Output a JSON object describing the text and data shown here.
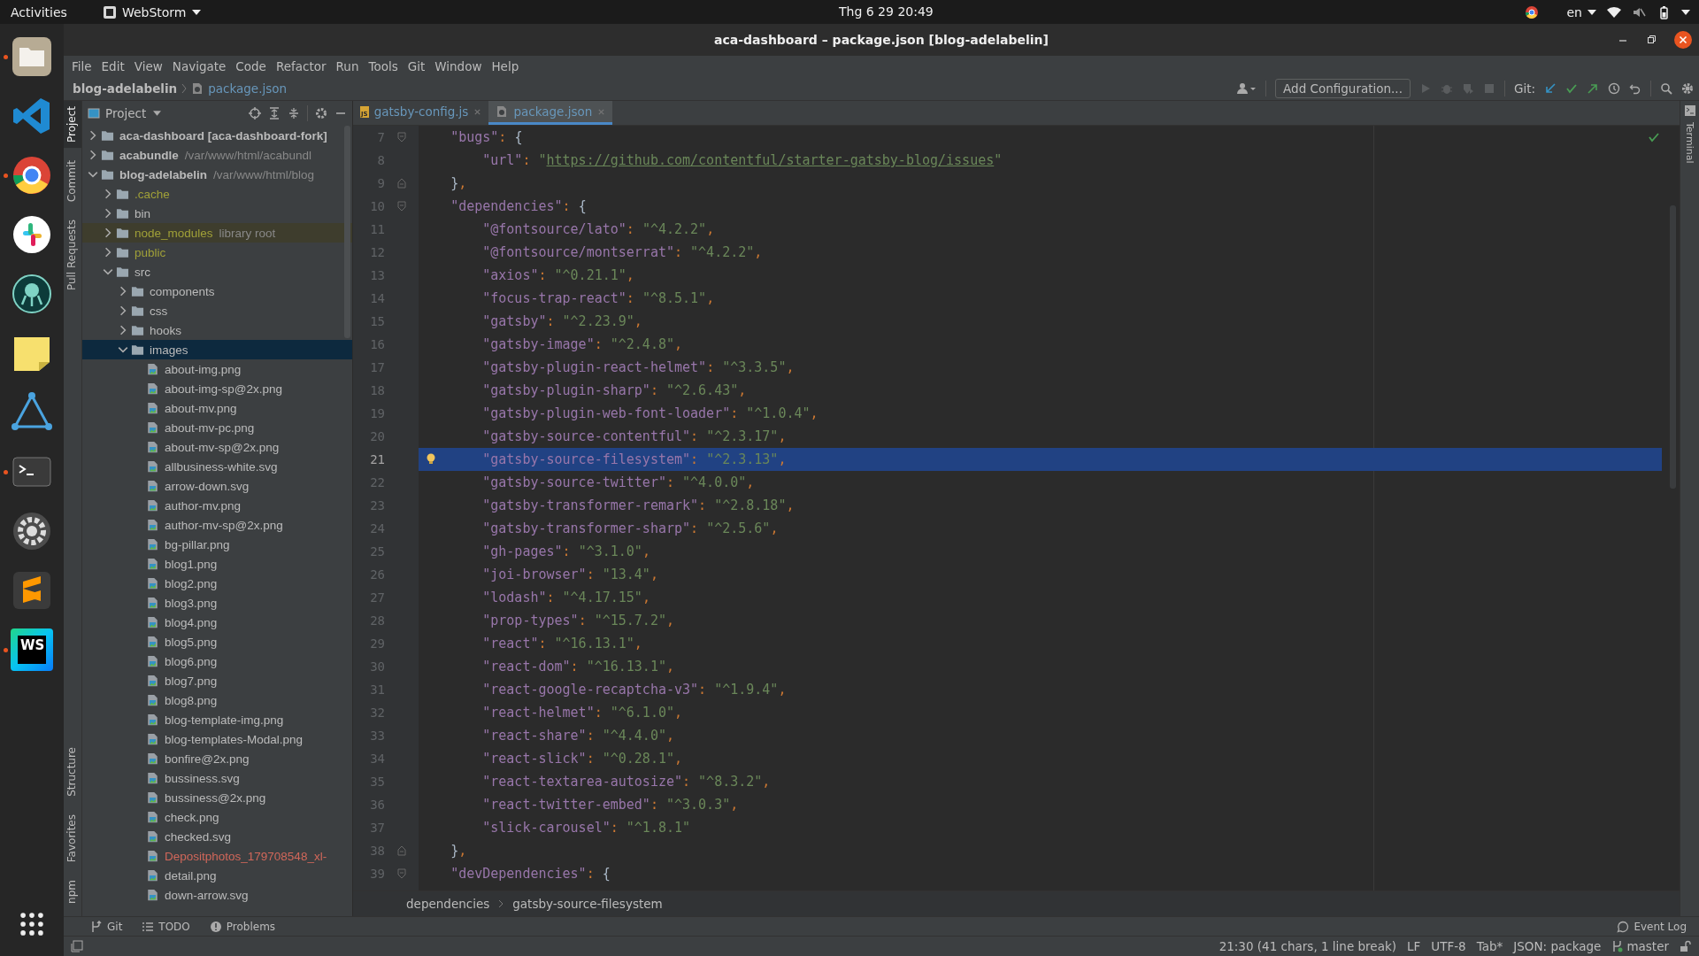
{
  "top_bar": {
    "activities": "Activities",
    "app_menu": "WebStorm",
    "clock": "Thg 6 29  20:49",
    "language": "en"
  },
  "dock": [
    {
      "kind": "files",
      "running": true
    },
    {
      "kind": "vscode",
      "running": false
    },
    {
      "kind": "chrome",
      "running": true
    },
    {
      "kind": "slack",
      "running": false
    },
    {
      "kind": "gitkraken",
      "running": false
    },
    {
      "kind": "notes",
      "running": false
    },
    {
      "kind": "triangle",
      "running": false
    },
    {
      "kind": "terminal",
      "running": true
    },
    {
      "kind": "settings",
      "running": false
    },
    {
      "kind": "sublime",
      "running": false
    },
    {
      "kind": "webstorm",
      "running": true,
      "label": "WS"
    },
    {
      "kind": "apps",
      "running": false
    }
  ],
  "window": {
    "title": "aca-dashboard – package.json [blog-adelabelin]"
  },
  "menu": [
    "File",
    "Edit",
    "View",
    "Navigate",
    "Code",
    "Refactor",
    "Run",
    "Tools",
    "Git",
    "Window",
    "Help"
  ],
  "nav": {
    "project": "blog-adelabelin",
    "file": "package.json",
    "run_config": "Add Configuration...",
    "git_label": "Git:"
  },
  "left_strip": {
    "top": [
      {
        "label": "Project",
        "selected": true
      },
      {
        "label": "Commit",
        "selected": false
      },
      {
        "label": "Pull Requests",
        "selected": false
      }
    ],
    "bottom": [
      {
        "label": "Structure",
        "selected": false
      },
      {
        "label": "Favorites",
        "selected": false
      },
      {
        "label": "npm",
        "selected": false
      }
    ]
  },
  "project_panel": {
    "title": "Project",
    "tree": [
      {
        "name": "aca-dashboard **[aca-dashboard-fork]**",
        "kind": "root",
        "color": "#bbbbbb",
        "expanded": false,
        "selected": false
      },
      {
        "name": "acabundle",
        "detail": "/var/www/html/acabundl",
        "kind": "root",
        "color": "#bbbbbb",
        "expanded": false,
        "selected": false
      },
      {
        "name": "blog-adelabelin",
        "detail": "/var/www/html/blog",
        "kind": "root",
        "color": "#bbbbbb",
        "expanded": true,
        "selected": false,
        "children": [
          {
            "name": ".cache",
            "kind": "folder",
            "color": "#a0a038",
            "expanded": false,
            "selected": false
          },
          {
            "name": "bin",
            "kind": "folder",
            "color": "#bbbbbb",
            "expanded": false,
            "selected": false
          },
          {
            "name": "node_modules",
            "detail": "library root",
            "kind": "library",
            "color": "#a0a038",
            "expanded": false,
            "selected": false
          },
          {
            "name": "public",
            "kind": "folder",
            "color": "#a0a038",
            "expanded": false,
            "selected": false
          },
          {
            "name": "src",
            "kind": "folder",
            "color": "#bbbbbb",
            "expanded": true,
            "selected": false,
            "children": [
              {
                "name": "components",
                "kind": "folder",
                "color": "#bbbbbb",
                "expanded": false,
                "selected": false
              },
              {
                "name": "css",
                "kind": "folder",
                "color": "#bbbbbb",
                "expanded": false,
                "selected": false
              },
              {
                "name": "hooks",
                "kind": "folder",
                "color": "#bbbbbb",
                "expanded": false,
                "selected": false
              },
              {
                "name": "images",
                "kind": "folder",
                "color": "#bbbbbb",
                "expanded": true,
                "selected": true,
                "children": [
                  {
                    "name": "about-img.png",
                    "kind": "file",
                    "color": "#bbbbbb",
                    "selected": false
                  },
                  {
                    "name": "about-img-sp@2x.png",
                    "kind": "file",
                    "color": "#bbbbbb",
                    "selected": false
                  },
                  {
                    "name": "about-mv.png",
                    "kind": "file",
                    "color": "#bbbbbb",
                    "selected": false
                  },
                  {
                    "name": "about-mv-pc.png",
                    "kind": "file",
                    "color": "#bbbbbb",
                    "selected": false
                  },
                  {
                    "name": "about-mv-sp@2x.png",
                    "kind": "file",
                    "color": "#bbbbbb",
                    "selected": false
                  },
                  {
                    "name": "allbusiness-white.svg",
                    "kind": "file",
                    "color": "#bbbbbb",
                    "selected": false
                  },
                  {
                    "name": "arrow-down.svg",
                    "kind": "file",
                    "color": "#bbbbbb",
                    "selected": false
                  },
                  {
                    "name": "author-mv.png",
                    "kind": "file",
                    "color": "#bbbbbb",
                    "selected": false
                  },
                  {
                    "name": "author-mv-sp@2x.png",
                    "kind": "file",
                    "color": "#bbbbbb",
                    "selected": false
                  },
                  {
                    "name": "bg-pillar.png",
                    "kind": "file",
                    "color": "#bbbbbb",
                    "selected": false
                  },
                  {
                    "name": "blog1.png",
                    "kind": "file",
                    "color": "#bbbbbb",
                    "selected": false
                  },
                  {
                    "name": "blog2.png",
                    "kind": "file",
                    "color": "#bbbbbb",
                    "selected": false
                  },
                  {
                    "name": "blog3.png",
                    "kind": "file",
                    "color": "#bbbbbb",
                    "selected": false
                  },
                  {
                    "name": "blog4.png",
                    "kind": "file",
                    "color": "#bbbbbb",
                    "selected": false
                  },
                  {
                    "name": "blog5.png",
                    "kind": "file",
                    "color": "#bbbbbb",
                    "selected": false
                  },
                  {
                    "name": "blog6.png",
                    "kind": "file",
                    "color": "#bbbbbb",
                    "selected": false
                  },
                  {
                    "name": "blog7.png",
                    "kind": "file",
                    "color": "#bbbbbb",
                    "selected": false
                  },
                  {
                    "name": "blog8.png",
                    "kind": "file",
                    "color": "#bbbbbb",
                    "selected": false
                  },
                  {
                    "name": "blog-template-img.png",
                    "kind": "file",
                    "color": "#bbbbbb",
                    "selected": false
                  },
                  {
                    "name": "blog-templates-Modal.png",
                    "kind": "file",
                    "color": "#bbbbbb",
                    "selected": false
                  },
                  {
                    "name": "bonfire@2x.png",
                    "kind": "file",
                    "color": "#bbbbbb",
                    "selected": false
                  },
                  {
                    "name": "bussiness.svg",
                    "kind": "file",
                    "color": "#bbbbbb",
                    "selected": false
                  },
                  {
                    "name": "bussiness@2x.png",
                    "kind": "file",
                    "color": "#bbbbbb",
                    "selected": false
                  },
                  {
                    "name": "check.png",
                    "kind": "file",
                    "color": "#bbbbbb",
                    "selected": false
                  },
                  {
                    "name": "checked.svg",
                    "kind": "file",
                    "color": "#bbbbbb",
                    "selected": false
                  },
                  {
                    "name": "Depositphotos_179708548_xl-",
                    "kind": "file",
                    "color": "#d1675a",
                    "selected": false
                  },
                  {
                    "name": "detail.png",
                    "kind": "file",
                    "color": "#bbbbbb",
                    "selected": false
                  },
                  {
                    "name": "down-arrow.svg",
                    "kind": "file",
                    "color": "#bbbbbb",
                    "selected": false
                  }
                ]
              }
            ]
          }
        ]
      }
    ]
  },
  "tabs": [
    {
      "label": "gatsby-config.js",
      "kind": "js",
      "badge": "JS",
      "selected": false
    },
    {
      "label": "package.json",
      "kind": "json",
      "selected": true
    }
  ],
  "editor": {
    "lines": [
      {
        "number": "7",
        "selected": false,
        "kind": "fold-start",
        "tokens": [
          {
            "kind": "key",
            "text": "    \"bugs\""
          },
          {
            "kind": "punct",
            "text": ": "
          },
          {
            "kind": "brace",
            "text": "{"
          }
        ]
      },
      {
        "number": "8",
        "selected": false,
        "tokens": [
          {
            "kind": "key",
            "text": "        \"url\""
          },
          {
            "kind": "punct",
            "text": ": "
          },
          {
            "kind": "string",
            "text": "\""
          },
          {
            "kind": "url",
            "text": "https://github.com/contentful/starter-gatsby-blog/issues"
          },
          {
            "kind": "string",
            "text": "\""
          }
        ]
      },
      {
        "number": "9",
        "selected": false,
        "kind": "fold-end",
        "tokens": [
          {
            "kind": "brace",
            "text": "    }"
          },
          {
            "kind": "punct",
            "text": ","
          }
        ]
      },
      {
        "number": "10",
        "selected": false,
        "kind": "fold-start",
        "tokens": [
          {
            "kind": "key",
            "text": "    \"dependencies\""
          },
          {
            "kind": "punct",
            "text": ": "
          },
          {
            "kind": "brace",
            "text": "{"
          }
        ]
      },
      {
        "number": "11",
        "selected": false,
        "tokens": [
          {
            "kind": "key",
            "text": "        \"@fontsource/lato\""
          },
          {
            "kind": "punct",
            "text": ": "
          },
          {
            "kind": "string",
            "text": "\"^4.2.2\""
          },
          {
            "kind": "punct",
            "text": ","
          }
        ]
      },
      {
        "number": "12",
        "selected": false,
        "tokens": [
          {
            "kind": "key",
            "text": "        \"@fontsource/montserrat\""
          },
          {
            "kind": "punct",
            "text": ": "
          },
          {
            "kind": "string",
            "text": "\"^4.2.2\""
          },
          {
            "kind": "punct",
            "text": ","
          }
        ]
      },
      {
        "number": "13",
        "selected": false,
        "tokens": [
          {
            "kind": "key",
            "text": "        \"axios\""
          },
          {
            "kind": "punct",
            "text": ": "
          },
          {
            "kind": "string",
            "text": "\"^0.21.1\""
          },
          {
            "kind": "punct",
            "text": ","
          }
        ]
      },
      {
        "number": "14",
        "selected": false,
        "tokens": [
          {
            "kind": "key",
            "text": "        \"focus-trap-react\""
          },
          {
            "kind": "punct",
            "text": ": "
          },
          {
            "kind": "string",
            "text": "\"^8.5.1\""
          },
          {
            "kind": "punct",
            "text": ","
          }
        ]
      },
      {
        "number": "15",
        "selected": false,
        "tokens": [
          {
            "kind": "key",
            "text": "        \"gatsby\""
          },
          {
            "kind": "punct",
            "text": ": "
          },
          {
            "kind": "string",
            "text": "\"^2.23.9\""
          },
          {
            "kind": "punct",
            "text": ","
          }
        ]
      },
      {
        "number": "16",
        "selected": false,
        "tokens": [
          {
            "kind": "key",
            "text": "        \"gatsby-image\""
          },
          {
            "kind": "punct",
            "text": ": "
          },
          {
            "kind": "string",
            "text": "\"^2.4.8\""
          },
          {
            "kind": "punct",
            "text": ","
          }
        ]
      },
      {
        "number": "17",
        "selected": false,
        "tokens": [
          {
            "kind": "key",
            "text": "        \"gatsby-plugin-react-helmet\""
          },
          {
            "kind": "punct",
            "text": ": "
          },
          {
            "kind": "string",
            "text": "\"^3.3.5\""
          },
          {
            "kind": "punct",
            "text": ","
          }
        ]
      },
      {
        "number": "18",
        "selected": false,
        "tokens": [
          {
            "kind": "key",
            "text": "        \"gatsby-plugin-sharp\""
          },
          {
            "kind": "punct",
            "text": ": "
          },
          {
            "kind": "string",
            "text": "\"^2.6.43\""
          },
          {
            "kind": "punct",
            "text": ","
          }
        ]
      },
      {
        "number": "19",
        "selected": false,
        "tokens": [
          {
            "kind": "key",
            "text": "        \"gatsby-plugin-web-font-loader\""
          },
          {
            "kind": "punct",
            "text": ": "
          },
          {
            "kind": "string",
            "text": "\"^1.0.4\""
          },
          {
            "kind": "punct",
            "text": ","
          }
        ]
      },
      {
        "number": "20",
        "selected": false,
        "tokens": [
          {
            "kind": "key",
            "text": "        \"gatsby-source-contentful\""
          },
          {
            "kind": "punct",
            "text": ": "
          },
          {
            "kind": "string",
            "text": "\"^2.3.17\""
          },
          {
            "kind": "punct",
            "text": ","
          }
        ]
      },
      {
        "number": "21",
        "selected": true,
        "tokens": [
          {
            "kind": "key",
            "text": "        \"gatsby-source-filesystem\""
          },
          {
            "kind": "punct",
            "text": ": "
          },
          {
            "kind": "string",
            "text": "\"^2.3.13\""
          },
          {
            "kind": "punct",
            "text": ","
          }
        ]
      },
      {
        "number": "22",
        "selected": false,
        "tokens": [
          {
            "kind": "key",
            "text": "        \"gatsby-source-twitter\""
          },
          {
            "kind": "punct",
            "text": ": "
          },
          {
            "kind": "string",
            "text": "\"^4.0.0\""
          },
          {
            "kind": "punct",
            "text": ","
          }
        ]
      },
      {
        "number": "23",
        "selected": false,
        "tokens": [
          {
            "kind": "key",
            "text": "        \"gatsby-transformer-remark\""
          },
          {
            "kind": "punct",
            "text": ": "
          },
          {
            "kind": "string",
            "text": "\"^2.8.18\""
          },
          {
            "kind": "punct",
            "text": ","
          }
        ]
      },
      {
        "number": "24",
        "selected": false,
        "tokens": [
          {
            "kind": "key",
            "text": "        \"gatsby-transformer-sharp\""
          },
          {
            "kind": "punct",
            "text": ": "
          },
          {
            "kind": "string",
            "text": "\"^2.5.6\""
          },
          {
            "kind": "punct",
            "text": ","
          }
        ]
      },
      {
        "number": "25",
        "selected": false,
        "tokens": [
          {
            "kind": "key",
            "text": "        \"gh-pages\""
          },
          {
            "kind": "punct",
            "text": ": "
          },
          {
            "kind": "string",
            "text": "\"^3.1.0\""
          },
          {
            "kind": "punct",
            "text": ","
          }
        ]
      },
      {
        "number": "26",
        "selected": false,
        "tokens": [
          {
            "kind": "key",
            "text": "        \"joi-browser\""
          },
          {
            "kind": "punct",
            "text": ": "
          },
          {
            "kind": "string",
            "text": "\"13.4\""
          },
          {
            "kind": "punct",
            "text": ","
          }
        ]
      },
      {
        "number": "27",
        "selected": false,
        "tokens": [
          {
            "kind": "key",
            "text": "        \"lodash\""
          },
          {
            "kind": "punct",
            "text": ": "
          },
          {
            "kind": "string",
            "text": "\"^4.17.15\""
          },
          {
            "kind": "punct",
            "text": ","
          }
        ]
      },
      {
        "number": "28",
        "selected": false,
        "tokens": [
          {
            "kind": "key",
            "text": "        \"prop-types\""
          },
          {
            "kind": "punct",
            "text": ": "
          },
          {
            "kind": "string",
            "text": "\"^15.7.2\""
          },
          {
            "kind": "punct",
            "text": ","
          }
        ]
      },
      {
        "number": "29",
        "selected": false,
        "tokens": [
          {
            "kind": "key",
            "text": "        \"react\""
          },
          {
            "kind": "punct",
            "text": ": "
          },
          {
            "kind": "string",
            "text": "\"^16.13.1\""
          },
          {
            "kind": "punct",
            "text": ","
          }
        ]
      },
      {
        "number": "30",
        "selected": false,
        "tokens": [
          {
            "kind": "key",
            "text": "        \"react-dom\""
          },
          {
            "kind": "punct",
            "text": ": "
          },
          {
            "kind": "string",
            "text": "\"^16.13.1\""
          },
          {
            "kind": "punct",
            "text": ","
          }
        ]
      },
      {
        "number": "31",
        "selected": false,
        "tokens": [
          {
            "kind": "key",
            "text": "        \"react-google-recaptcha-v3\""
          },
          {
            "kind": "punct",
            "text": ": "
          },
          {
            "kind": "string",
            "text": "\"^1.9.4\""
          },
          {
            "kind": "punct",
            "text": ","
          }
        ]
      },
      {
        "number": "32",
        "selected": false,
        "tokens": [
          {
            "kind": "key",
            "text": "        \"react-helmet\""
          },
          {
            "kind": "punct",
            "text": ": "
          },
          {
            "kind": "string",
            "text": "\"^6.1.0\""
          },
          {
            "kind": "punct",
            "text": ","
          }
        ]
      },
      {
        "number": "33",
        "selected": false,
        "tokens": [
          {
            "kind": "key",
            "text": "        \"react-share\""
          },
          {
            "kind": "punct",
            "text": ": "
          },
          {
            "kind": "string",
            "text": "\"^4.4.0\""
          },
          {
            "kind": "punct",
            "text": ","
          }
        ]
      },
      {
        "number": "34",
        "selected": false,
        "tokens": [
          {
            "kind": "key",
            "text": "        \"react-slick\""
          },
          {
            "kind": "punct",
            "text": ": "
          },
          {
            "kind": "string",
            "text": "\"^0.28.1\""
          },
          {
            "kind": "punct",
            "text": ","
          }
        ]
      },
      {
        "number": "35",
        "selected": false,
        "tokens": [
          {
            "kind": "key",
            "text": "        \"react-textarea-autosize\""
          },
          {
            "kind": "punct",
            "text": ": "
          },
          {
            "kind": "string",
            "text": "\"^8.3.2\""
          },
          {
            "kind": "punct",
            "text": ","
          }
        ]
      },
      {
        "number": "36",
        "selected": false,
        "tokens": [
          {
            "kind": "key",
            "text": "        \"react-twitter-embed\""
          },
          {
            "kind": "punct",
            "text": ": "
          },
          {
            "kind": "string",
            "text": "\"^3.0.3\""
          },
          {
            "kind": "punct",
            "text": ","
          }
        ]
      },
      {
        "number": "37",
        "selected": false,
        "tokens": [
          {
            "kind": "key",
            "text": "        \"slick-carousel\""
          },
          {
            "kind": "punct",
            "text": ": "
          },
          {
            "kind": "string",
            "text": "\"^1.8.1\""
          }
        ]
      },
      {
        "number": "38",
        "selected": false,
        "kind": "fold-end",
        "tokens": [
          {
            "kind": "brace",
            "text": "    }"
          },
          {
            "kind": "punct",
            "text": ","
          }
        ]
      },
      {
        "number": "39",
        "selected": false,
        "kind": "fold-start",
        "tokens": [
          {
            "kind": "key",
            "text": "    \"devDependencies\""
          },
          {
            "kind": "punct",
            "text": ": "
          },
          {
            "kind": "brace",
            "text": "{"
          }
        ]
      }
    ],
    "breadcrumbs": [
      "dependencies",
      "gatsby-source-filesystem"
    ]
  },
  "right_strip": [
    "Terminal"
  ],
  "bottom_tools": [
    {
      "label": "Git",
      "kind": "git"
    },
    {
      "label": "TODO",
      "kind": "todo"
    },
    {
      "label": "Problems",
      "kind": "problems"
    }
  ],
  "event_log": "Event Log",
  "status_bar": {
    "items": [
      "21:30 (41 chars, 1 line break)",
      "LF",
      "UTF-8",
      "Tab*",
      "JSON: package"
    ],
    "branch": "master"
  }
}
